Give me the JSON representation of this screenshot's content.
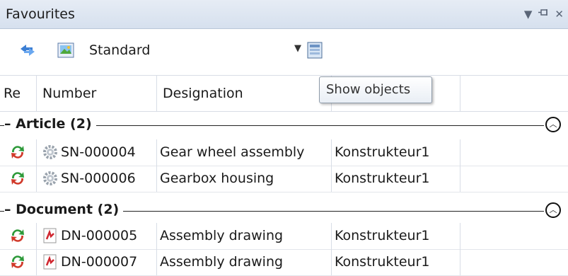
{
  "panel": {
    "title": "Favourites"
  },
  "toolbar": {
    "view_select_value": "Standard",
    "tooltip": "Show objects"
  },
  "columns": [
    "Re",
    "Number",
    "Designation"
  ],
  "groups": [
    {
      "label": "– Article (2)",
      "rows": [
        {
          "number": "SN-000004",
          "designation": "Gear wheel assembly",
          "created_by": "Konstrukteur1"
        },
        {
          "number": "SN-000006",
          "designation": "Gearbox housing",
          "created_by": "Konstrukteur1"
        }
      ]
    },
    {
      "label": "– Document (2)",
      "rows": [
        {
          "number": "DN-000005",
          "designation": "Assembly drawing",
          "created_by": "Konstrukteur1"
        },
        {
          "number": "DN-000007",
          "designation": "Assembly drawing",
          "created_by": "Konstrukteur1"
        }
      ]
    }
  ],
  "icons": {
    "pin": "pin-icon",
    "dropdown": "dropdown-arrow-icon",
    "close": "close-icon",
    "refresh": "refresh-icon",
    "image": "image-icon",
    "show_objects": "show-objects-icon",
    "status": "sync-status-icon",
    "article": "gear-icon",
    "document": "pdf-document-icon"
  }
}
